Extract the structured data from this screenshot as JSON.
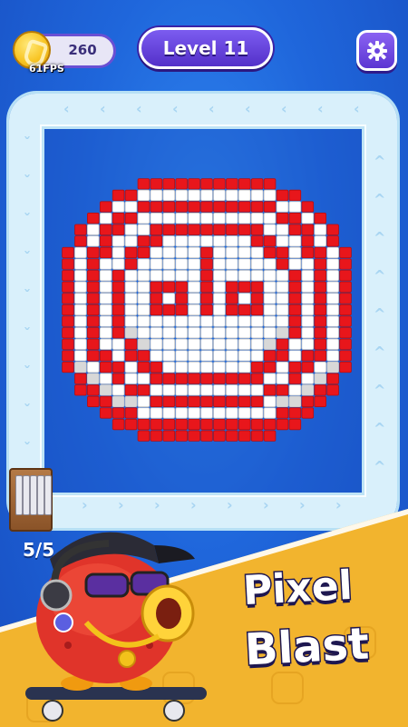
{
  "hud": {
    "coins": "260",
    "fps": "61FPS",
    "level": "Level 11"
  },
  "icons": {
    "coin": "coin-icon",
    "settings": "gear-icon"
  },
  "launcher": {
    "counter": "5/5"
  },
  "promo": {
    "title_line1": "Pixel",
    "title_line2": "Blast"
  },
  "colors": {
    "background": "#1f66db",
    "pixel_red": "#e8161b",
    "pixel_white": "#ffffff",
    "pixel_gray": "#d8d8d8",
    "belt": "#d9f0fb",
    "promo_panel": "#f2b42e",
    "level_pill": "#6a45e0"
  },
  "pixel_art": {
    "rows": [
      "......RRRRRRRRRRR......",
      "....RRWWWWWWWWWWWRR....",
      "...RWWRRRRRRRRRRRWWR...",
      "..RWRRWWWWWWWWWWWRRWR..",
      ".RWRRWWRRRRRRRRRWWRRWR.",
      ".RWRWWRRWWWWWWWRRWWRWR.",
      "RWRRWRRWWWWRWWWWRRWRRWR",
      "RWRWWRWWWWWRWWWWWRWWRWR",
      "RWRWRWWWWWWRWWWWWWRWRWR",
      "RWRWRWWRRRWRWRRRWWRWRWR",
      "RWRWRWWRWRWRWRWRWWRWRWR",
      "RWRWRWWRRRWRWRRRWWRWRWR",
      "RWRWRWWWWWWWWWWWWWRWRWR",
      "RWRWRGWWWWWWWWWWWGRWRWR",
      "RWRWWRGWWWWWWWWWGRWWRWR",
      "RWRRWRRWWWWWWWWWRRWRRWR",
      "RGWRRWRRWWWWWWWRRWRRWGR",
      ".RGWRWWRRRRRRRRRWWRWGR.",
      ".RRGWRRWWWWWWWWWRRWGRR.",
      "..RRGGWRRRRRRRRRWGGRR..",
      "...RRRWWWWWWWWWWWRRR...",
      "....RRRRRRRRRRRRRRR....",
      "......RRRRRRRRRRR......"
    ]
  }
}
